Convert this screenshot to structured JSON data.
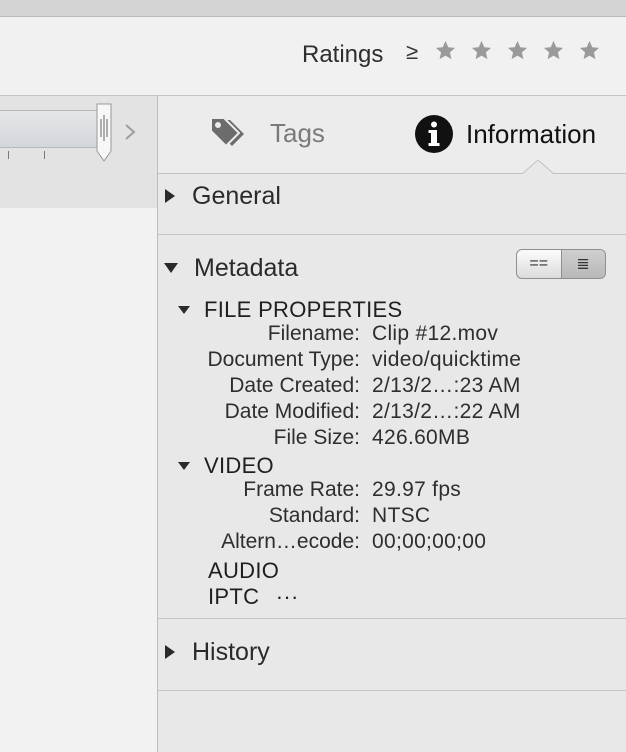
{
  "toolbar": {
    "ratings_label": "Ratings",
    "ratings_operator": "≥",
    "ratings_stars": 5,
    "ratings_selected": 0
  },
  "tabs": [
    {
      "label": "Tags",
      "icon": "tag-icon",
      "active": false
    },
    {
      "label": "Information",
      "icon": "info-icon",
      "active": true
    }
  ],
  "sections": {
    "general": {
      "label": "General",
      "expanded": false
    },
    "metadata": {
      "label": "Metadata",
      "expanded": true
    },
    "history": {
      "label": "History",
      "expanded": false
    }
  },
  "view_toggle": {
    "options": [
      "==",
      "≣"
    ],
    "selected": 1
  },
  "file_properties": {
    "label": "FILE PROPERTIES",
    "rows": [
      {
        "key": "Filename:",
        "value": "Clip #12.mov"
      },
      {
        "key": "Document Type:",
        "value": "video/quicktime"
      },
      {
        "key": "Date Created:",
        "value": "2/13/2…:23 AM"
      },
      {
        "key": "Date Modified:",
        "value": "2/13/2…:22 AM"
      },
      {
        "key": "File Size:",
        "value": "426.60MB"
      }
    ]
  },
  "video": {
    "label": "VIDEO",
    "rows": [
      {
        "key": "Frame Rate:",
        "value": "29.97 fps"
      },
      {
        "key": "Standard:",
        "value": "NTSC"
      },
      {
        "key": "Altern…ecode:",
        "value": "00;00;00;00"
      }
    ]
  },
  "audio": {
    "label": "AUDIO"
  },
  "iptc": {
    "label": "IPTC",
    "more": "···"
  },
  "colors": {
    "panel": "#e8e8e8",
    "text": "#2b2b2b",
    "inactive_tab": "#7a7a7a"
  }
}
